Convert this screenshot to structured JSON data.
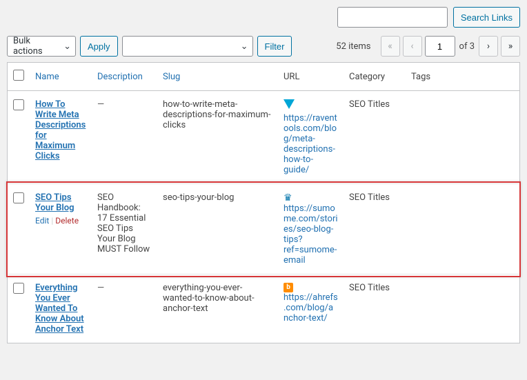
{
  "search": {
    "placeholder": "",
    "button": "Search Links"
  },
  "bulk": {
    "label": "Bulk actions",
    "apply": "Apply"
  },
  "filter": {
    "selected": "",
    "button": "Filter"
  },
  "pagination": {
    "items_text": "52 items",
    "current": "1",
    "of_text": "of 3"
  },
  "columns": {
    "name": "Name",
    "description": "Description",
    "slug": "Slug",
    "url": "URL",
    "category": "Category",
    "tags": "Tags"
  },
  "actions": {
    "edit": "Edit",
    "delete": "Delete"
  },
  "rows": [
    {
      "name": "How To Write Meta Descriptions for Maximum Clicks",
      "description": "—",
      "slug": "how-to-write-meta-descriptions-for-maximum-clicks",
      "url": "https://raventools.com/blog/meta-descriptions-how-to-guide/",
      "category": "SEO Titles",
      "tags": "",
      "favicon": "raven"
    },
    {
      "name": "SEO Tips Your Blog",
      "description": "SEO Handbook: 17 Essential SEO Tips Your Blog MUST Follow",
      "slug": "seo-tips-your-blog",
      "url": "https://sumome.com/stories/seo-blog-tips?ref=sumome-email",
      "category": "SEO Titles",
      "tags": "",
      "favicon": "crown",
      "show_actions": true
    },
    {
      "name": "Everything You Ever Wanted To Know About Anchor Text",
      "description": "—",
      "slug": "everything-you-ever-wanted-to-know-about-anchor-text",
      "url": "https://ahrefs.com/blog/anchor-text/",
      "category": "SEO Titles",
      "tags": "",
      "favicon": "b"
    }
  ]
}
